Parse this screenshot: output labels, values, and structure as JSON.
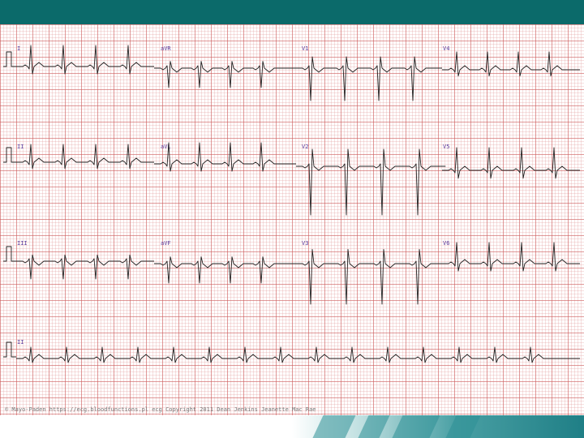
{
  "leads": {
    "row1": [
      "I",
      "aVR",
      "V1",
      "V4"
    ],
    "row2": [
      "II",
      "aVL",
      "V2",
      "V5"
    ],
    "row3": [
      "III",
      "aVF",
      "V3",
      "V6"
    ],
    "rhythm": "II"
  },
  "footer": {
    "text": "© Mayo-Paden   https://ecg.bloodfunctions.pl ecg   Copyright 2011 Dean Jenkins Jeanette Mac Rae"
  },
  "colors": {
    "header_bar": "#0b6a6a",
    "grid_major": "#cd5f5f",
    "grid_minor": "#e6a5a5",
    "trace": "#222222",
    "label": "#5a3fa0",
    "accent_band": "#1f7f86"
  }
}
